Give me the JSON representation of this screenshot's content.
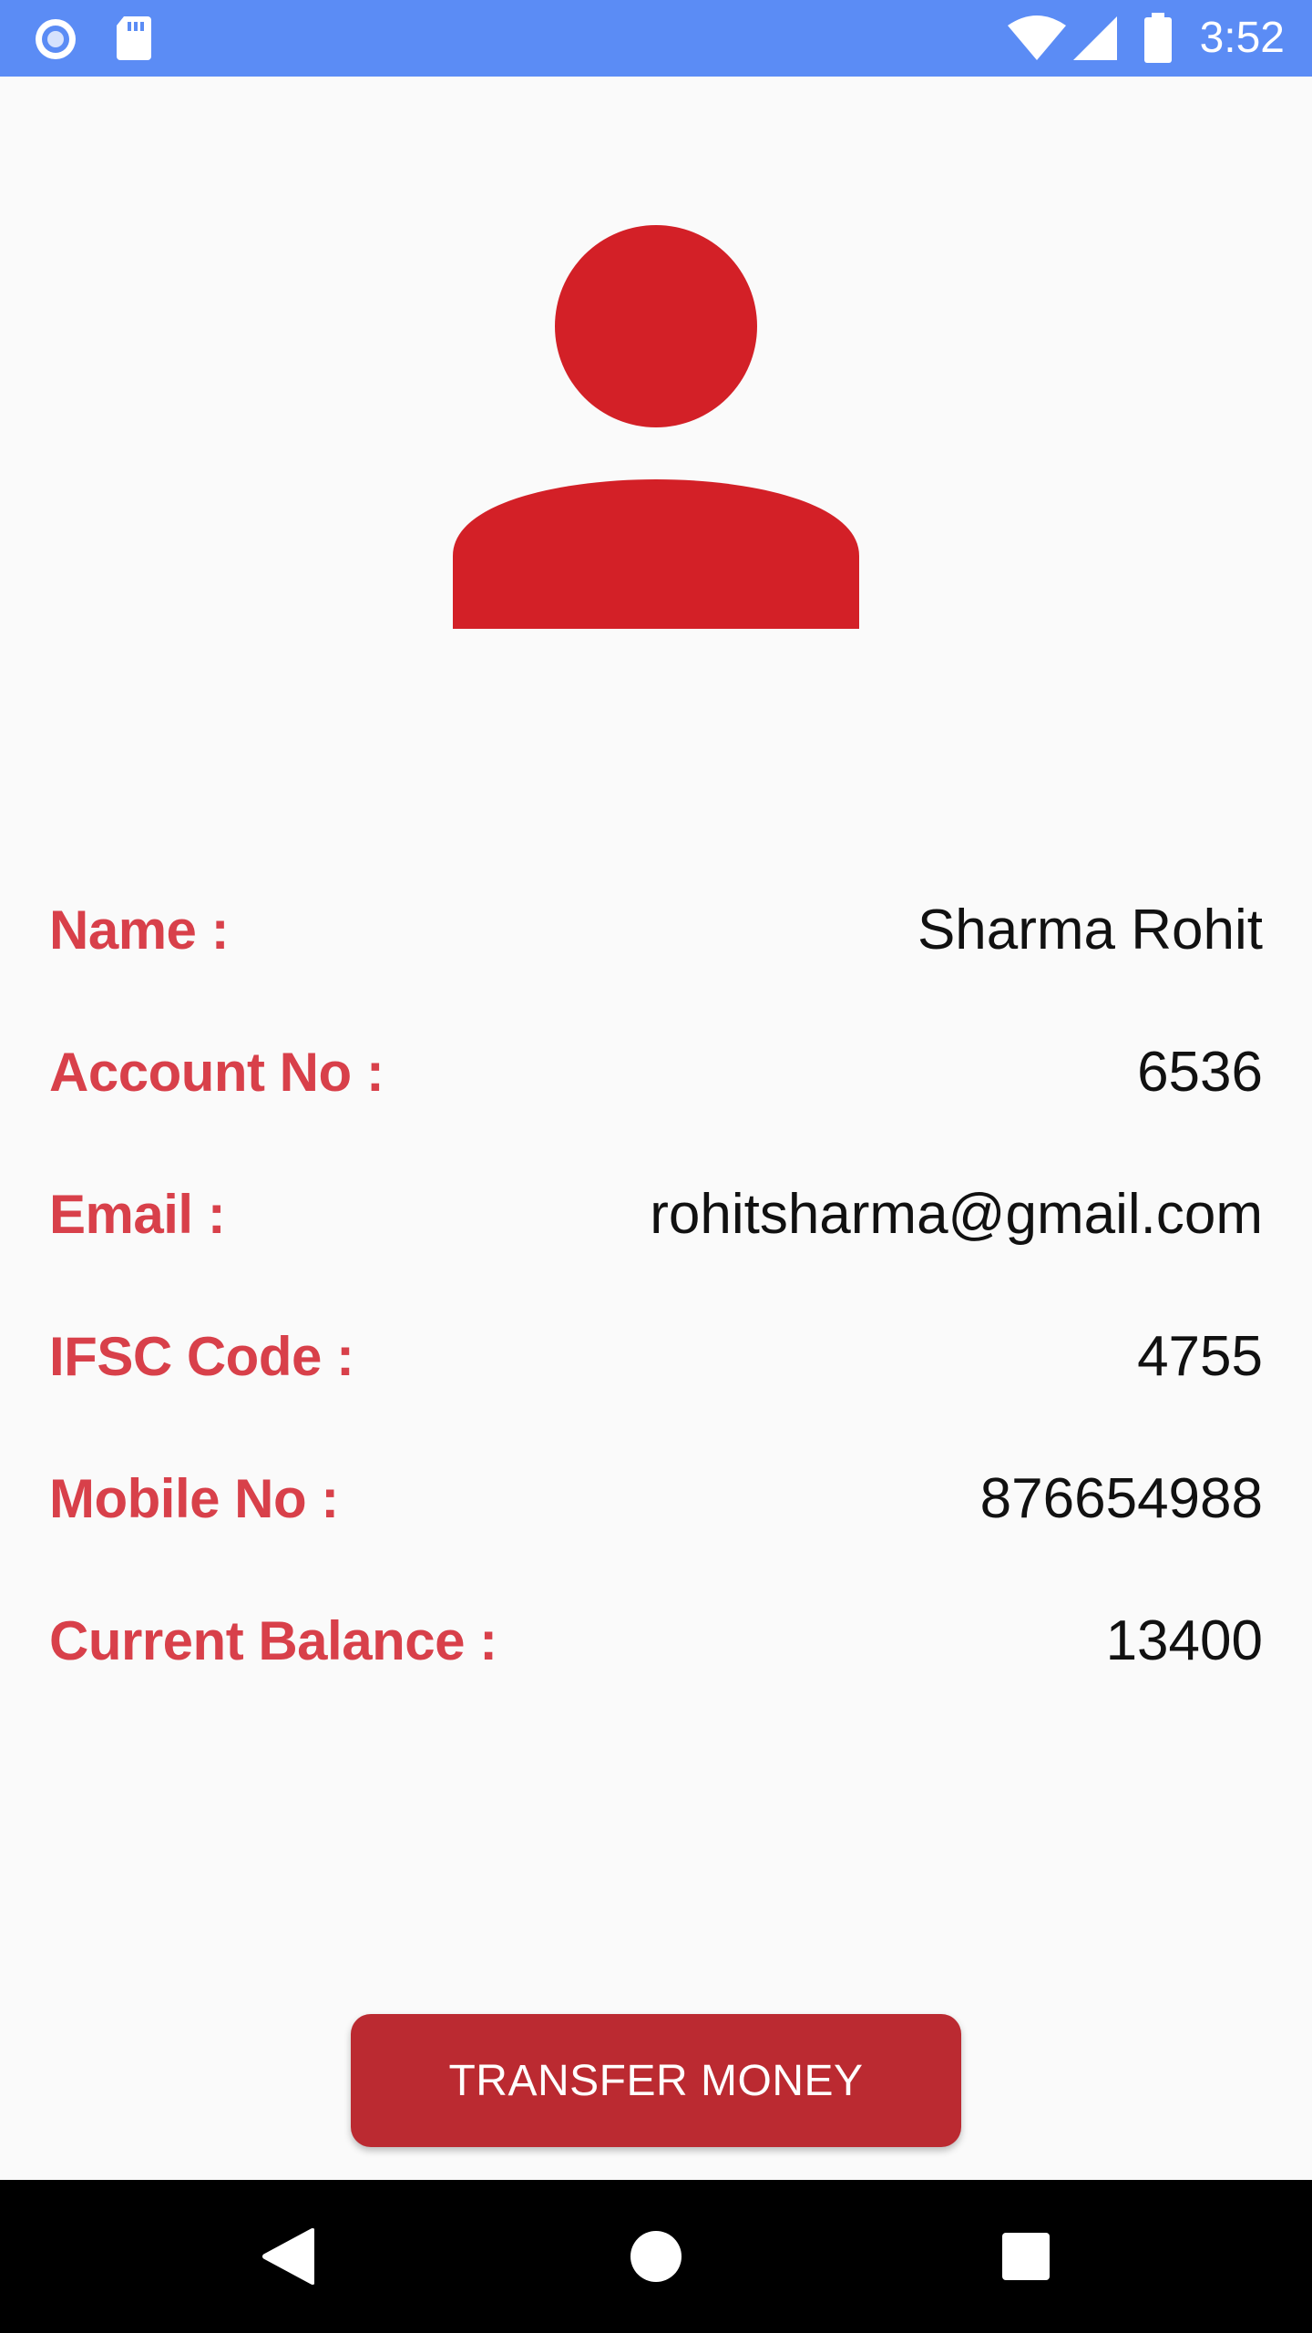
{
  "status_bar": {
    "time": "3:52",
    "icons": [
      "record-icon",
      "sd-card-icon",
      "wifi-icon",
      "signal-icon",
      "battery-icon"
    ]
  },
  "profile": {
    "avatar_icon": "person-icon",
    "accent_color": "#d32027"
  },
  "details": [
    {
      "label": "Name :",
      "value": "Sharma Rohit"
    },
    {
      "label": "Account No :",
      "value": "6536"
    },
    {
      "label": "Email :",
      "value": "rohitsharma@gmail.com"
    },
    {
      "label": "IFSC Code :",
      "value": "4755"
    },
    {
      "label": "Mobile No :",
      "value": "876654988"
    },
    {
      "label": "Current Balance :",
      "value": "13400"
    }
  ],
  "actions": {
    "transfer_label": "TRANSFER MONEY"
  },
  "nav_bar": {
    "icons": [
      "back-icon",
      "home-icon",
      "recents-icon"
    ]
  },
  "colors": {
    "status_bar": "#5b8cf5",
    "label": "#d8404a",
    "button": "#bb2a31"
  }
}
